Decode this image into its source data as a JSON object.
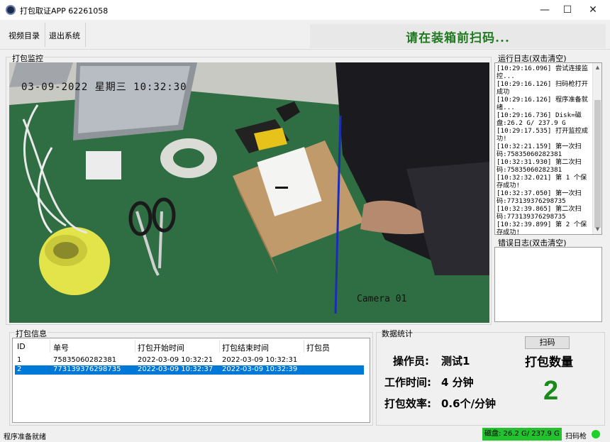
{
  "window": {
    "title": "打包取证APP 62261058",
    "minimize_glyph": "—",
    "maximize_glyph": "☐",
    "close_glyph": "✕"
  },
  "menu": {
    "items": [
      "视频目录",
      "退出系统"
    ],
    "prompt": "请在装箱前扫码..."
  },
  "monitor": {
    "label": "打包监控",
    "osd_datetime": "03-09-2022 星期三 10:32:30",
    "osd_camera": "Camera 01"
  },
  "run_log": {
    "label": "运行日志(双击清空)",
    "text": "[10:29:16.096] 尝试连接监控...\n[10:29:16.126] 扫码枪打开成功\n[10:29:16.126] 程序准备就绪...\n[10:29:16.736] Disk=磁盘:26.2 G/ 237.9 G\n[10:29:17.535] 打开监控成功!\n[10:32:21.159] 第一次扫码:75835060282381\n[10:32:31.930] 第二次扫码:75835060282381\n[10:32:32.021] 第 1 个保存成功!\n[10:32:37.050] 第一次扫码:773139376298735\n[10:32:39.865] 第二次扫码:773139376298735\n[10:32:39.899] 第 2 个保存成功!"
  },
  "error_log": {
    "label": "错误日志(双击清空)",
    "text": ""
  },
  "pack_info": {
    "label": "打包信息",
    "headers": [
      "ID",
      "单号",
      "打包开始时间",
      "打包结束时间",
      "打包员"
    ],
    "rows": [
      {
        "id": "1",
        "order": "75835060282381",
        "start": "2022-03-09 10:32:21",
        "end": "2022-03-09 10:32:31",
        "packer": ""
      },
      {
        "id": "2",
        "order": "773139376298735",
        "start": "2022-03-09 10:32:37",
        "end": "2022-03-09 10:32:39",
        "packer": ""
      }
    ]
  },
  "stats": {
    "label": "数据统计",
    "operator_label": "操作员:",
    "operator_value": "测试1",
    "worktime_label": "工作时间:",
    "worktime_value": "4 分钟",
    "efficiency_label": "打包效率:",
    "efficiency_value": "0.6个/分钟",
    "scan_button": "扫码",
    "count_label": "打包数量",
    "count_value": "2"
  },
  "status": {
    "text": "程序准备就绪",
    "disk": "磁盘: 26.2 G/ 237.9 G",
    "scanner_label": "扫码枪",
    "disk_color": "#22c22e",
    "scanner_color": "#1ed12a"
  }
}
